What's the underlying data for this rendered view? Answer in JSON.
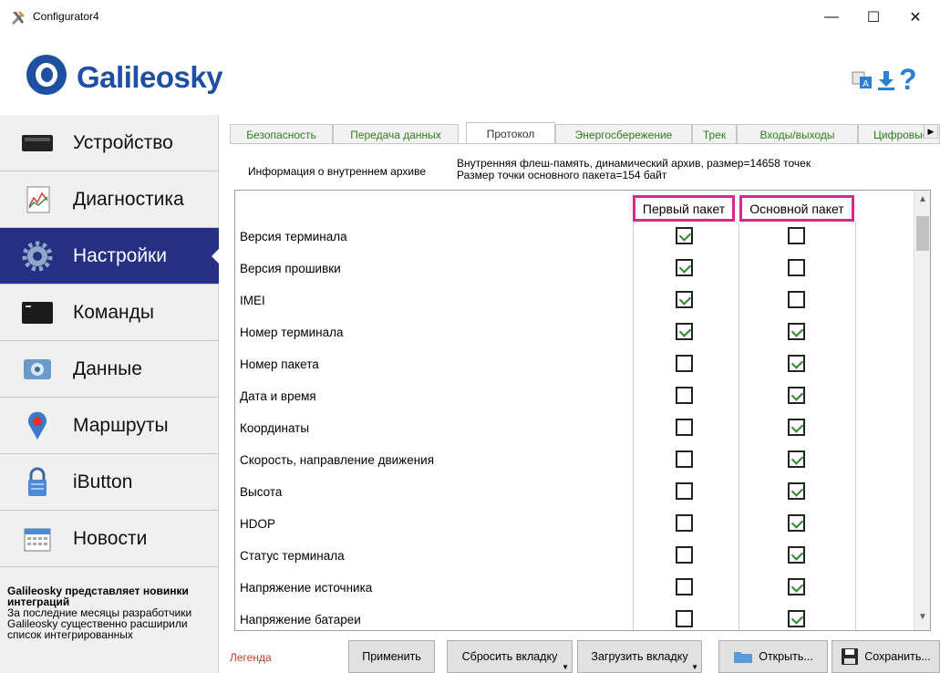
{
  "window": {
    "title": "Configurator4",
    "min_glyph": "—",
    "max_glyph": "☐",
    "close_glyph": "✕"
  },
  "header": {
    "logo_text": "Galileosky",
    "icons": [
      "language-icon",
      "download-icon",
      "help-icon"
    ],
    "help_glyph": "?",
    "brand_color": "#1e4fa0"
  },
  "sidebar": {
    "items": [
      {
        "label": "Устройство",
        "icon": "device-icon"
      },
      {
        "label": "Диагностика",
        "icon": "diagnostics-icon"
      },
      {
        "label": "Настройки",
        "icon": "settings-gear-icon",
        "active": true
      },
      {
        "label": "Команды",
        "icon": "terminal-icon"
      },
      {
        "label": "Данные",
        "icon": "data-icon"
      },
      {
        "label": "Маршруты",
        "icon": "map-pin-icon"
      },
      {
        "label": "iButton",
        "icon": "lock-icon"
      },
      {
        "label": "Новости",
        "icon": "calendar-icon"
      }
    ],
    "active_color": "#253085",
    "news": {
      "title": "Galileosky представляет новинки интеграций",
      "body": "За последние месяцы разработчики Galileosky существенно расширили список интегрированных"
    }
  },
  "tabs": [
    {
      "label": "Безопасность"
    },
    {
      "label": "Передача данных"
    },
    {
      "label": "Протокол",
      "active": true
    },
    {
      "label": "Энергосбережение"
    },
    {
      "label": "Трек"
    },
    {
      "label": "Входы/выходы"
    },
    {
      "label": "Цифровые"
    }
  ],
  "info": {
    "label": "Информация о внутреннем архиве",
    "line1": "Внутренняя флеш-память, динамический архив, размер=14658 точек",
    "line2": "Размер точки основного пакета=154 байт"
  },
  "grid": {
    "col_first": "Первый пакет",
    "col_main": "Основной пакет",
    "highlight_color": "#d6298a",
    "rows": [
      {
        "label": "Версия терминала",
        "first": true,
        "main": false
      },
      {
        "label": "Версия прошивки",
        "first": true,
        "main": false
      },
      {
        "label": "IMEI",
        "first": true,
        "main": false
      },
      {
        "label": "Номер терминала",
        "first": true,
        "main": true
      },
      {
        "label": "Номер пакета",
        "first": false,
        "main": true
      },
      {
        "label": "Дата и время",
        "first": false,
        "main": true
      },
      {
        "label": "Координаты",
        "first": false,
        "main": true
      },
      {
        "label": "Скорость, направление движения",
        "first": false,
        "main": true
      },
      {
        "label": "Высота",
        "first": false,
        "main": true
      },
      {
        "label": "HDOP",
        "first": false,
        "main": true
      },
      {
        "label": "Статус терминала",
        "first": false,
        "main": true
      },
      {
        "label": "Напряжение источника",
        "first": false,
        "main": true
      },
      {
        "label": "Напряжение батареи",
        "first": false,
        "main": true
      }
    ]
  },
  "bottom": {
    "legend": "Легенда",
    "apply": "Применить",
    "reset_tab": "Сбросить вкладку",
    "load_tab": "Загрузить вкладку",
    "open": "Открыть...",
    "save": "Сохранить..."
  }
}
